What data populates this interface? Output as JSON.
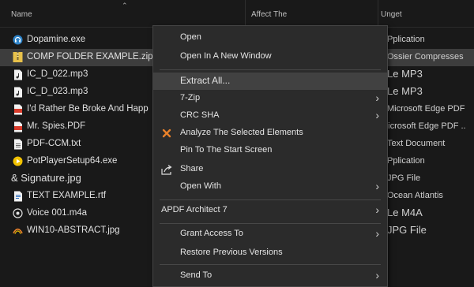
{
  "header": {
    "name": "Name",
    "date": "Affect The",
    "type": "Unget"
  },
  "files": [
    {
      "name": "Dopamine.exe",
      "type": "Pplication",
      "icon": "headphones-icon"
    },
    {
      "name": "COMP FOLDER EXAMPLE.zip",
      "type": "Ossier Compresses",
      "icon": "zip-folder-icon"
    },
    {
      "name": "IC_D_022.mp3",
      "type": "Le MP3",
      "icon": "audio-file-icon"
    },
    {
      "name": "IC_D_023.mp3",
      "type": "Le MP3",
      "icon": "audio-file-icon"
    },
    {
      "name": "I'd Rather Be Broke And Happ",
      "type": "Microsoft Edge PDF",
      "icon": "pdf-icon"
    },
    {
      "name": "Mr. Spies.PDF",
      "type": "Microsoft Edge PDF ..",
      "icon": "pdf-icon"
    },
    {
      "name": "PDF-CCM.txt",
      "type": "Text Document",
      "icon": "text-file-icon"
    },
    {
      "name": "PotPlayerSetup64.exe",
      "type": "Pplication",
      "icon": "potplayer-icon"
    },
    {
      "name": "& Signature.jpg",
      "type": "JPG File",
      "icon": ""
    },
    {
      "name": "TEXT EXAMPLE.rtf",
      "type": "Ocean Atlantis",
      "icon": "rtf-file-icon"
    },
    {
      "name": "Voice 001.m4a",
      "type": "Le M4A",
      "icon": "audio-file-icon"
    },
    {
      "name": "WIN10-ABSTRACT.jpg",
      "type": "JPG File",
      "icon": "image-icon"
    }
  ],
  "context_menu": {
    "items": [
      {
        "label": "Open",
        "submenu": false,
        "icon": ""
      },
      {
        "label": "Open In A New Window",
        "submenu": false,
        "icon": ""
      },
      {
        "label": "Extract All...",
        "submenu": false,
        "icon": ""
      },
      {
        "label": "7-Zip",
        "submenu": true,
        "icon": ""
      },
      {
        "label": "CRC SHA",
        "submenu": true,
        "icon": ""
      },
      {
        "label": "Analyze The Selected Elements",
        "submenu": false,
        "icon": "defender-icon"
      },
      {
        "label": "Pin To The Start Screen",
        "submenu": false,
        "icon": ""
      },
      {
        "label": "Share",
        "submenu": false,
        "icon": "share-icon"
      },
      {
        "label": "Open With",
        "submenu": true,
        "icon": ""
      },
      {
        "label": "APDF Architect 7",
        "submenu": true,
        "icon": ""
      },
      {
        "label": "Grant Access To",
        "submenu": true,
        "icon": ""
      },
      {
        "label": "Restore Previous Versions",
        "submenu": false,
        "icon": ""
      },
      {
        "label": "Send To",
        "submenu": true,
        "icon": ""
      }
    ]
  },
  "colors": {
    "background": "#191919",
    "menu_background": "#2b2b2b",
    "selected_row": "#3d3d3d",
    "highlight": "#414141",
    "folder_yellow": "#e8c14a",
    "pdf_red": "#d93b2b",
    "defender_orange": "#e8812a",
    "potplayer_yellow": "#f2c200"
  }
}
